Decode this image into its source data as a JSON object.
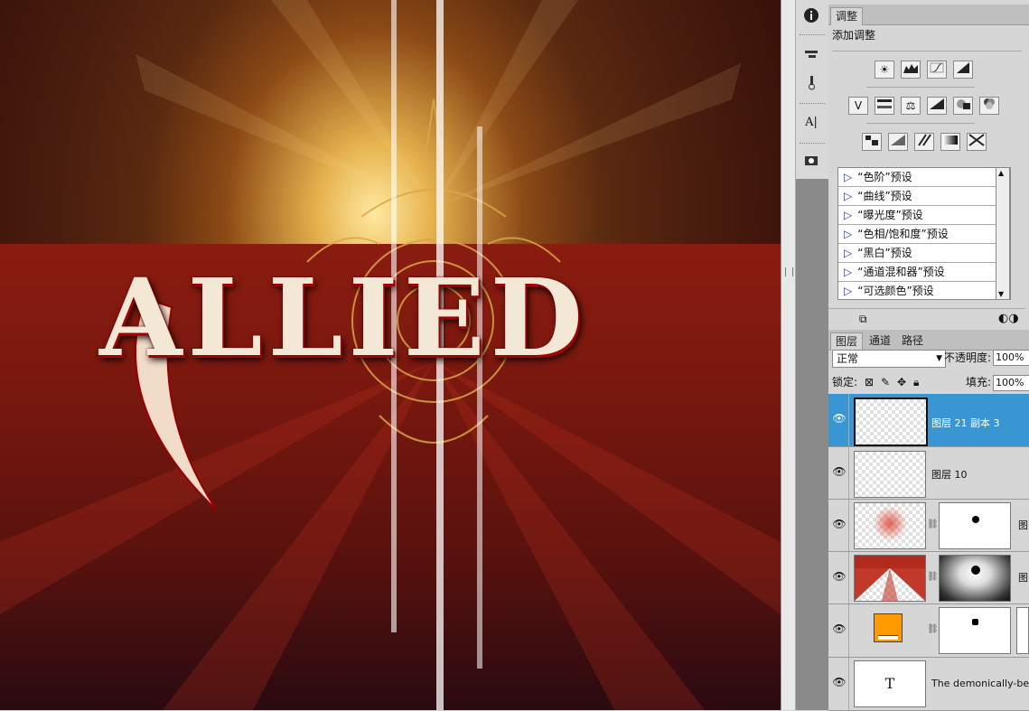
{
  "canvas": {
    "logo_text": "ALLIED"
  },
  "toolstrip": {
    "buttons": [
      "info-icon",
      "brush-presets-icon",
      "clone-source-icon",
      "character-icon",
      "layer-comps-icon"
    ]
  },
  "adjustments_panel": {
    "tab": "调整",
    "subtitle": "添加调整",
    "presets": [
      "“色阶”预设",
      "“曲线”预设",
      "“曝光度”预设",
      "“色相/饱和度”预设",
      "“黑白”预设",
      "“通道混和器”预设",
      "“可选颜色”预设"
    ]
  },
  "layers_panel": {
    "tabs": [
      "图层",
      "通道",
      "路径"
    ],
    "blend_mode": "正常",
    "opacity_label": "不透明度:",
    "opacity_value": "100%",
    "lock_label": "锁定:",
    "fill_label": "填充:",
    "fill_value": "100%",
    "layers": [
      {
        "name": "图层 21 副本 3",
        "selected": true
      },
      {
        "name": "图层 10",
        "selected": false
      },
      {
        "name": "图",
        "selected": false
      },
      {
        "name": "图",
        "selected": false
      },
      {
        "name": "",
        "selected": false
      },
      {
        "name": "The demonically-besieg",
        "selected": false
      }
    ],
    "text_layer_glyph": "T"
  },
  "colors": {
    "selection": "#3a96d2",
    "fill_layer_swatch": "#ff9900"
  }
}
